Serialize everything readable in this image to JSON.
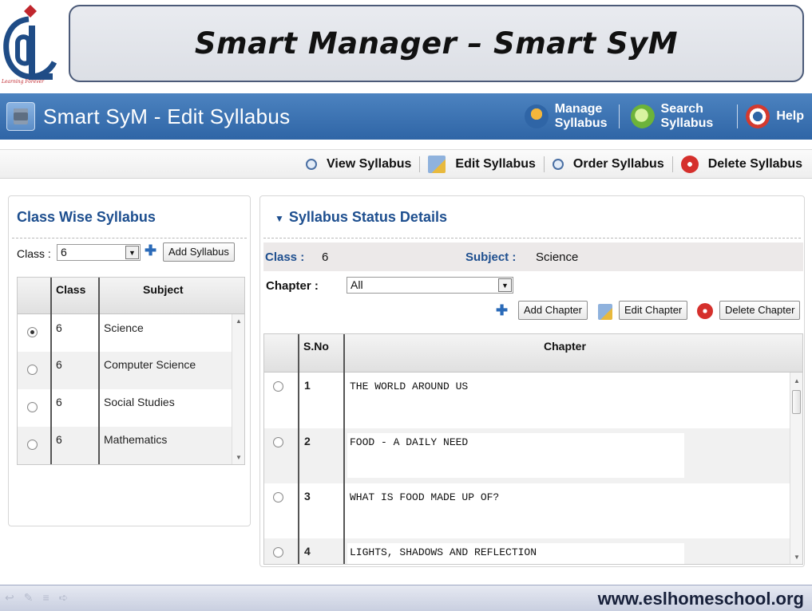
{
  "slide": {
    "logo_tagline": "Learning Forever",
    "title": "Smart Manager – Smart SyM"
  },
  "app": {
    "title": "Smart SyM - Edit Syllabus",
    "nav": [
      {
        "line1": "Manage",
        "line2": "Syllabus",
        "icon": "manage-syllabus-icon"
      },
      {
        "line1": "Search",
        "line2": "Syllabus",
        "icon": "search-syllabus-icon"
      },
      {
        "line1": "Help",
        "line2": "",
        "icon": "help-icon"
      }
    ]
  },
  "toolbar": {
    "view": "View Syllabus",
    "edit": "Edit Syllabus",
    "order": "Order Syllabus",
    "delete": "Delete Syllabus"
  },
  "left": {
    "title": "Class Wise Syllabus",
    "class_label": "Class :",
    "class_value": "6",
    "add_button": "Add Syllabus",
    "columns": [
      "Class",
      "Subject"
    ],
    "rows": [
      {
        "class": "6",
        "subject": "Science",
        "selected": true
      },
      {
        "class": "6",
        "subject": "Computer Science",
        "selected": false
      },
      {
        "class": "6",
        "subject": "Social Studies",
        "selected": false
      },
      {
        "class": "6",
        "subject": "Mathematics",
        "selected": false
      }
    ]
  },
  "right": {
    "title": "Syllabus Status Details",
    "class_label": "Class :",
    "class_value": "6",
    "subject_label": "Subject :",
    "subject_value": "Science",
    "chapter_label": "Chapter :",
    "chapter_value": "All",
    "add_chapter": "Add Chapter",
    "edit_chapter": "Edit Chapter",
    "delete_chapter": "Delete Chapter",
    "columns": [
      "S.No",
      "Chapter"
    ],
    "rows": [
      {
        "sno": "1",
        "chapter": "THE WORLD AROUND US"
      },
      {
        "sno": "2",
        "chapter": "FOOD - A DAILY NEED"
      },
      {
        "sno": "3",
        "chapter": "WHAT IS FOOD MADE UP OF?"
      },
      {
        "sno": "4",
        "chapter": "LIGHTS, SHADOWS AND REFLECTION"
      }
    ]
  },
  "footer": {
    "website": "www.eslhomeschool.org"
  },
  "colors": {
    "app_bar": "#3a70b0",
    "heading_blue": "#1e4f8f",
    "delete_red": "#d5302c"
  }
}
